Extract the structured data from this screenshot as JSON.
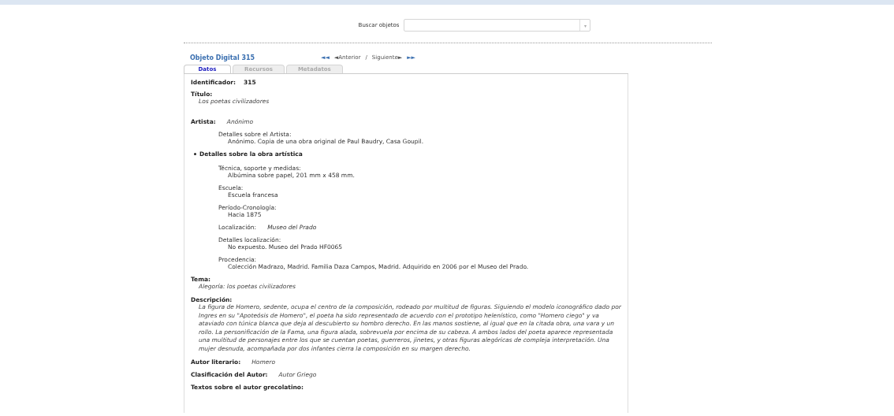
{
  "search": {
    "label": "Buscar objetos",
    "dropdown_icon": "▾"
  },
  "object": {
    "title": "Objeto Digital 315",
    "nav": {
      "first": "◄◄",
      "prev": "◄Anterior",
      "separator": "/",
      "next": "Siguiente►",
      "last": "►►"
    }
  },
  "tabs": [
    {
      "label": "Datos",
      "selected": true
    },
    {
      "label": "Recursos",
      "selected": false
    },
    {
      "label": "Metadatos",
      "selected": false
    }
  ],
  "fields": [
    {
      "kind": "inline-strong",
      "label": "Identificador:",
      "value": "315"
    },
    {
      "kind": "block",
      "label": "Título:",
      "value": "Los poetas civilizadores"
    },
    {
      "kind": "spacer"
    },
    {
      "kind": "inline",
      "label": "Artista:",
      "value": "Anónimo"
    },
    {
      "kind": "sub-block",
      "label": "Detalles sobre el Artista:",
      "value": "Anónimo. Copia de una obra original de Paul Baudry, Casa Goupil."
    },
    {
      "kind": "section",
      "label": "Detalles sobre la obra artística"
    },
    {
      "kind": "sub-block",
      "label": "Técnica, soporte y medidas:",
      "value": "Albúmina sobre papel, 201 mm x 458 mm."
    },
    {
      "kind": "sub-block",
      "label": "Escuela:",
      "value": "Escuela francesa"
    },
    {
      "kind": "sub-block",
      "label": "Período-Cronología:",
      "value": "Hacia 1875"
    },
    {
      "kind": "sub-inline",
      "label": "Localización:",
      "value": "Museo del Prado"
    },
    {
      "kind": "sub-block",
      "label": "Detalles localización:",
      "value": "No expuesto. Museo del Prado HF0065"
    },
    {
      "kind": "sub-block",
      "label": "Procedencia:",
      "value": "Colección Madrazo, Madrid. Familia Daza Campos, Madrid. Adquirido en 2006 por el Museo del Prado."
    },
    {
      "kind": "block",
      "label": "Tema:",
      "value": "Alegoría: los poetas civilizadores"
    },
    {
      "kind": "block",
      "label": "Descripción:",
      "value": "La figura de Homero, sedente, ocupa el centro de la composición, rodeado por multitud de figuras. Siguiendo el modelo iconográfico dado por Ingres en su \"Apoteósis de Homero\", el poeta ha sido representado de acuerdo con el prototipo helenístico, como \"Homero ciego\" y va ataviado con túnica blanca que deja al descubierto su hombro derecho. En las manos sostiene, al igual que en la citada obra, una vara y un rollo. La personificación de la Fama, una figura alada, sobrevuela por encima de su cabeza. A ambos lados del poeta aparece representada una multitud de personajes entre los que se cuentan poetas, guerreros, jinetes, y otras figuras alegóricas de compleja interpretación. Una mujer desnuda, acompañada por dos infantes cierra la composición en su margen derecho."
    },
    {
      "kind": "inline",
      "label": "Autor literario:",
      "value": "Homero"
    },
    {
      "kind": "inline",
      "label": "Clasificación del Autor:",
      "value": "Autor Griego"
    },
    {
      "kind": "heading",
      "label": "Textos sobre el autor grecolatino:"
    }
  ]
}
